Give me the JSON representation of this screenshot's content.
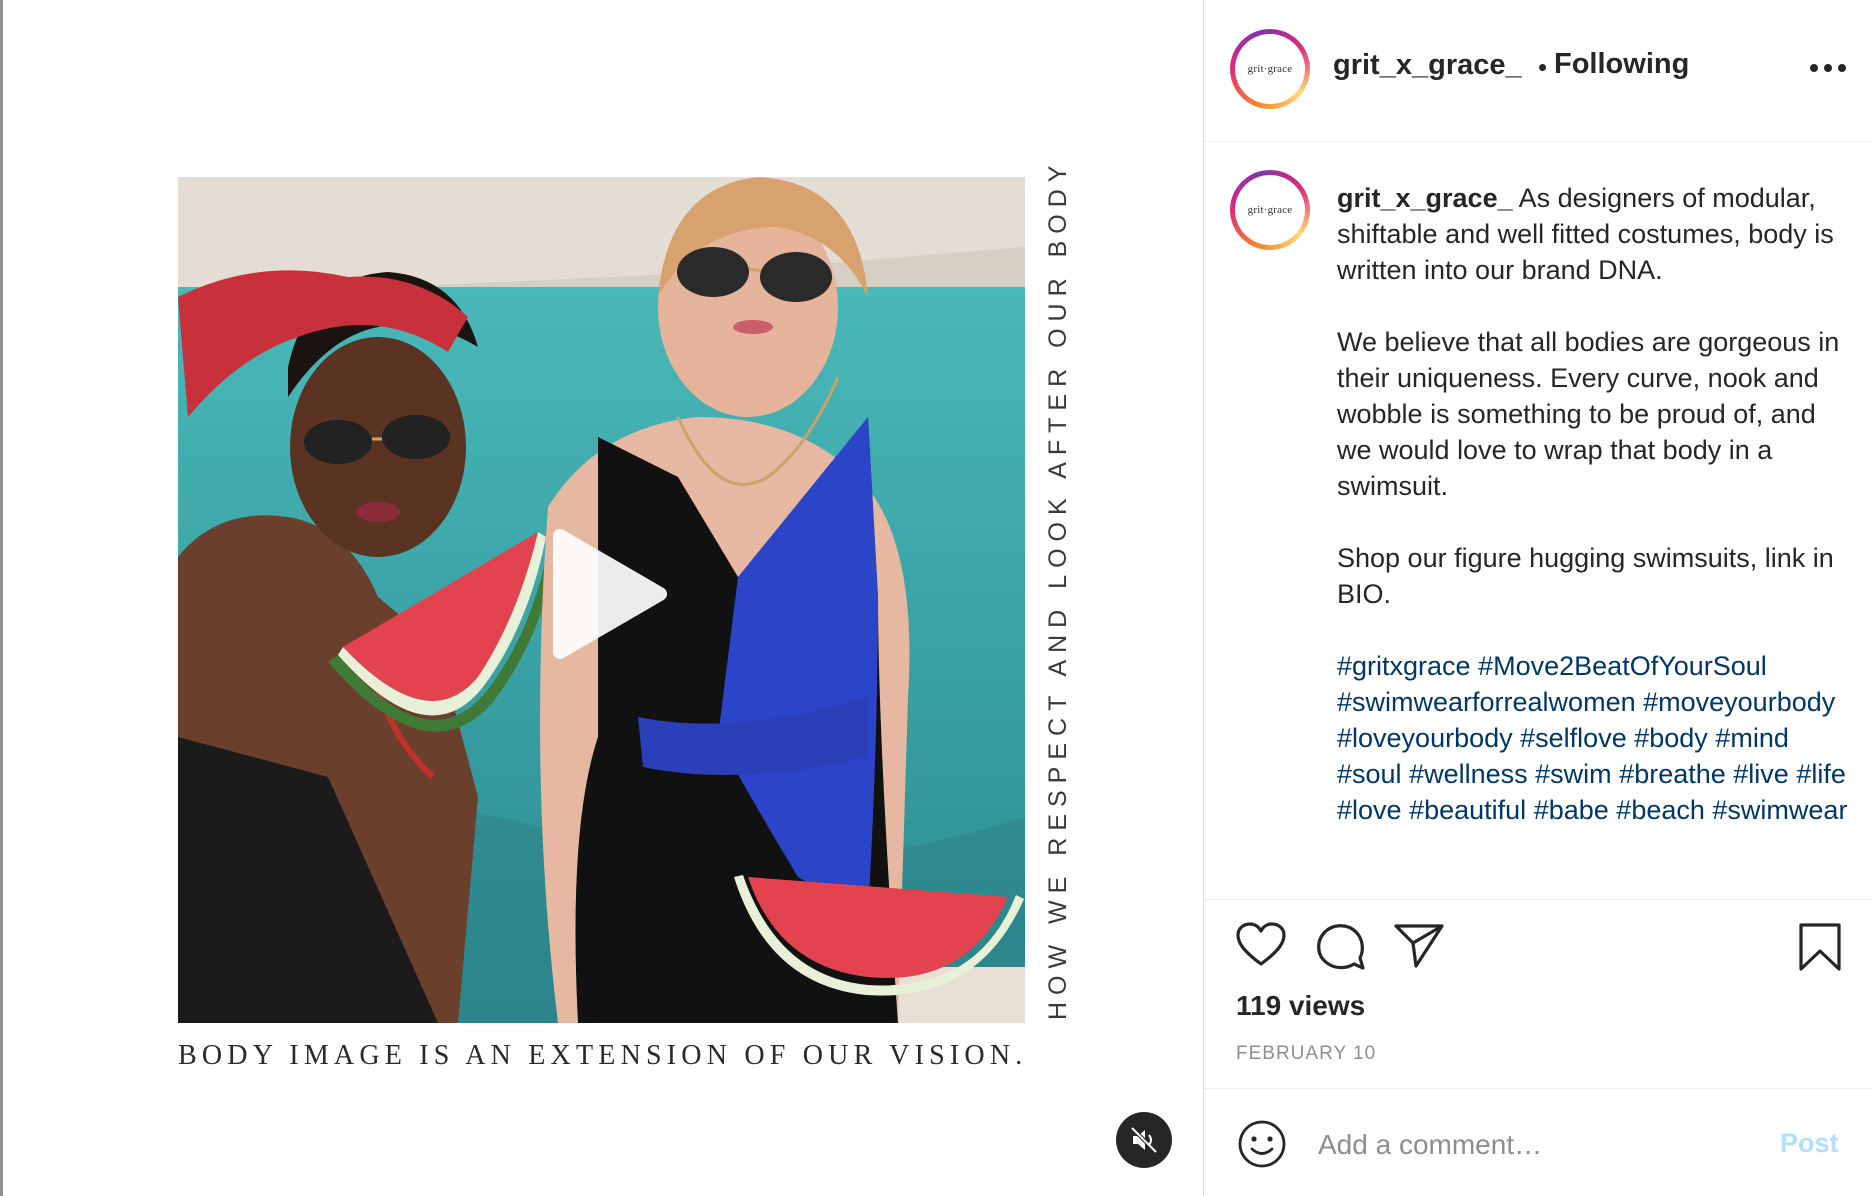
{
  "post": {
    "username": "grit_x_grace_",
    "follow_status": "Following",
    "separator": "•",
    "avatar_text": "grit·grace",
    "caption": {
      "intro": "As designers of modular, shiftable and well fitted costumes, body is written into our brand DNA.",
      "paragraph2": "We believe that all bodies are gorgeous in their uniqueness. Every curve, nook and wobble is something to be proud of, and we would love to wrap that body in a swimsuit.",
      "paragraph3": "Shop our figure hugging swimsuits, link in BIO.",
      "hashtags": [
        "#gritxgrace",
        "#Move2BeatOfYourSoul",
        "#swimwearforrealwomen",
        "#moveyourbody",
        "#loveyourbody",
        "#selflove",
        "#body",
        "#mind",
        "#soul",
        "#wellness",
        "#swim",
        "#breathe",
        "#live",
        "#life",
        "#love",
        "#beautiful",
        "#babe",
        "#beach",
        "#swimwear"
      ]
    },
    "views": "119 views",
    "date": "FEBRUARY 10"
  },
  "media": {
    "vertical_text": "HOW WE RESPECT AND LOOK AFTER OUR BODY",
    "bottom_text": "BODY IMAGE IS AN EXTENSION OF OUR VISION."
  },
  "comment_box": {
    "placeholder": "Add a comment…",
    "post_label": "Post"
  },
  "icons": {
    "play": "play-icon",
    "mute": "muted-speaker-icon",
    "more": "more-horizontal-icon",
    "like": "heart-icon",
    "comment": "comment-bubble-icon",
    "share": "paper-plane-icon",
    "save": "bookmark-icon",
    "emoji": "smiley-icon"
  },
  "colors": {
    "link": "#00376b",
    "post_disabled": "#b2dffc",
    "muted_text": "#8e8e8e"
  }
}
